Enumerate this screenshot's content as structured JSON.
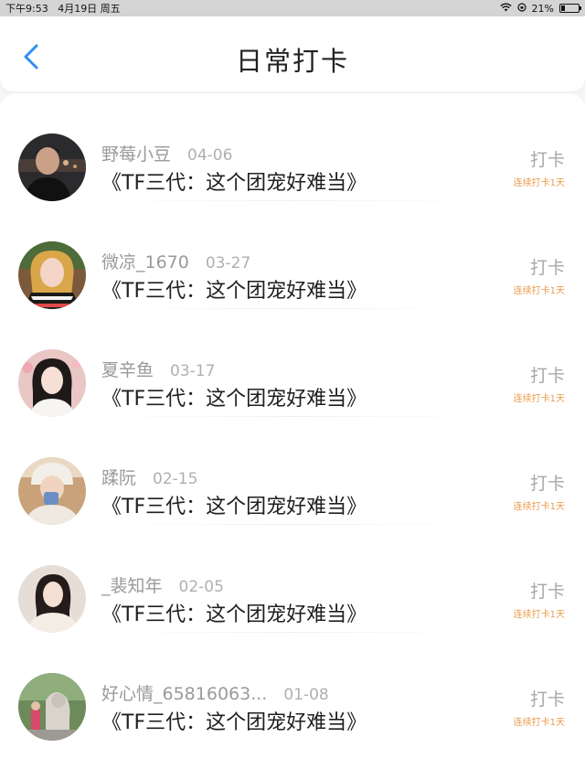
{
  "status_bar": {
    "time_date": "下午9:53   4月19日 周五",
    "battery_text": "21%",
    "battery_level": 0.21
  },
  "header": {
    "back_icon": "chevron-left-icon",
    "title": "日常打卡",
    "accent_color": "#2f8ff0"
  },
  "entries": [
    {
      "name": "野莓小豆",
      "date": "04-06",
      "book": "《TF三代：这个团宠好难当》",
      "action": "打卡",
      "streak": "连续打卡1天"
    },
    {
      "name": "微凉_1670",
      "date": "03-27",
      "book": "《TF三代：这个团宠好难当》",
      "action": "打卡",
      "streak": "连续打卡1天"
    },
    {
      "name": "夏辛鱼",
      "date": "03-17",
      "book": "《TF三代：这个团宠好难当》",
      "action": "打卡",
      "streak": "连续打卡1天"
    },
    {
      "name": "蹂阮",
      "date": "02-15",
      "book": "《TF三代：这个团宠好难当》",
      "action": "打卡",
      "streak": "连续打卡1天"
    },
    {
      "name": "_裴知年",
      "date": "02-05",
      "book": "《TF三代：这个团宠好难当》",
      "action": "打卡",
      "streak": "连续打卡1天"
    },
    {
      "name": "好心情_65816063...",
      "date": "01-08",
      "book": "《TF三代：这个团宠好难当》",
      "action": "打卡",
      "streak": "连续打卡1天"
    }
  ],
  "colors": {
    "streak": "#e89a4b",
    "name": "#9a9a9a"
  }
}
